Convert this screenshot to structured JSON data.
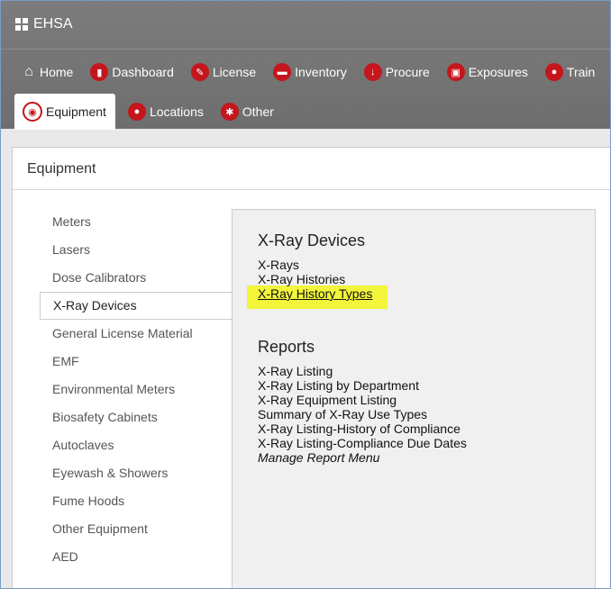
{
  "app": {
    "brand": "EHSA"
  },
  "nav": {
    "row1": [
      {
        "label": "Home",
        "icon": "home-icon"
      },
      {
        "label": "Dashboard",
        "icon": "bar-chart-icon"
      },
      {
        "label": "License",
        "icon": "wrench-icon"
      },
      {
        "label": "Inventory",
        "icon": "car-icon"
      },
      {
        "label": "Procure",
        "icon": "arrow-down-icon"
      },
      {
        "label": "Exposures",
        "icon": "clipboard-icon"
      },
      {
        "label": "Train",
        "icon": "person-icon"
      }
    ],
    "row2": [
      {
        "label": "Equipment",
        "icon": "gauge-icon",
        "active": true
      },
      {
        "label": "Locations",
        "icon": "map-marker-icon"
      },
      {
        "label": "Other",
        "icon": "asterisk-icon"
      }
    ]
  },
  "panel": {
    "title": "Equipment"
  },
  "sidebar": {
    "items": [
      "Meters",
      "Lasers",
      "Dose Calibrators",
      "X-Ray Devices",
      "General License Material",
      "EMF",
      "Environmental Meters",
      "Biosafety Cabinets",
      "Autoclaves",
      "Eyewash & Showers",
      "Fume Hoods",
      "Other Equipment",
      "AED"
    ],
    "active": "X-Ray Devices"
  },
  "content": {
    "devices_title": "X-Ray Devices",
    "devices_links": [
      "X-Rays",
      "X-Ray Histories",
      "X-Ray History Types"
    ],
    "highlighted_link": "X-Ray History Types",
    "highlight_color": "#f2f53a",
    "reports_title": "Reports",
    "reports_links": [
      "X-Ray Listing",
      "X-Ray Listing by Department",
      "X-Ray Equipment Listing",
      "Summary of X-Ray Use Types",
      "X-Ray Listing-History of Compliance",
      "X-Ray Listing-Compliance Due Dates"
    ],
    "manage_link": "Manage Report Menu"
  },
  "colors": {
    "nav_bg": "#737373",
    "icon_red": "#c4161c"
  }
}
